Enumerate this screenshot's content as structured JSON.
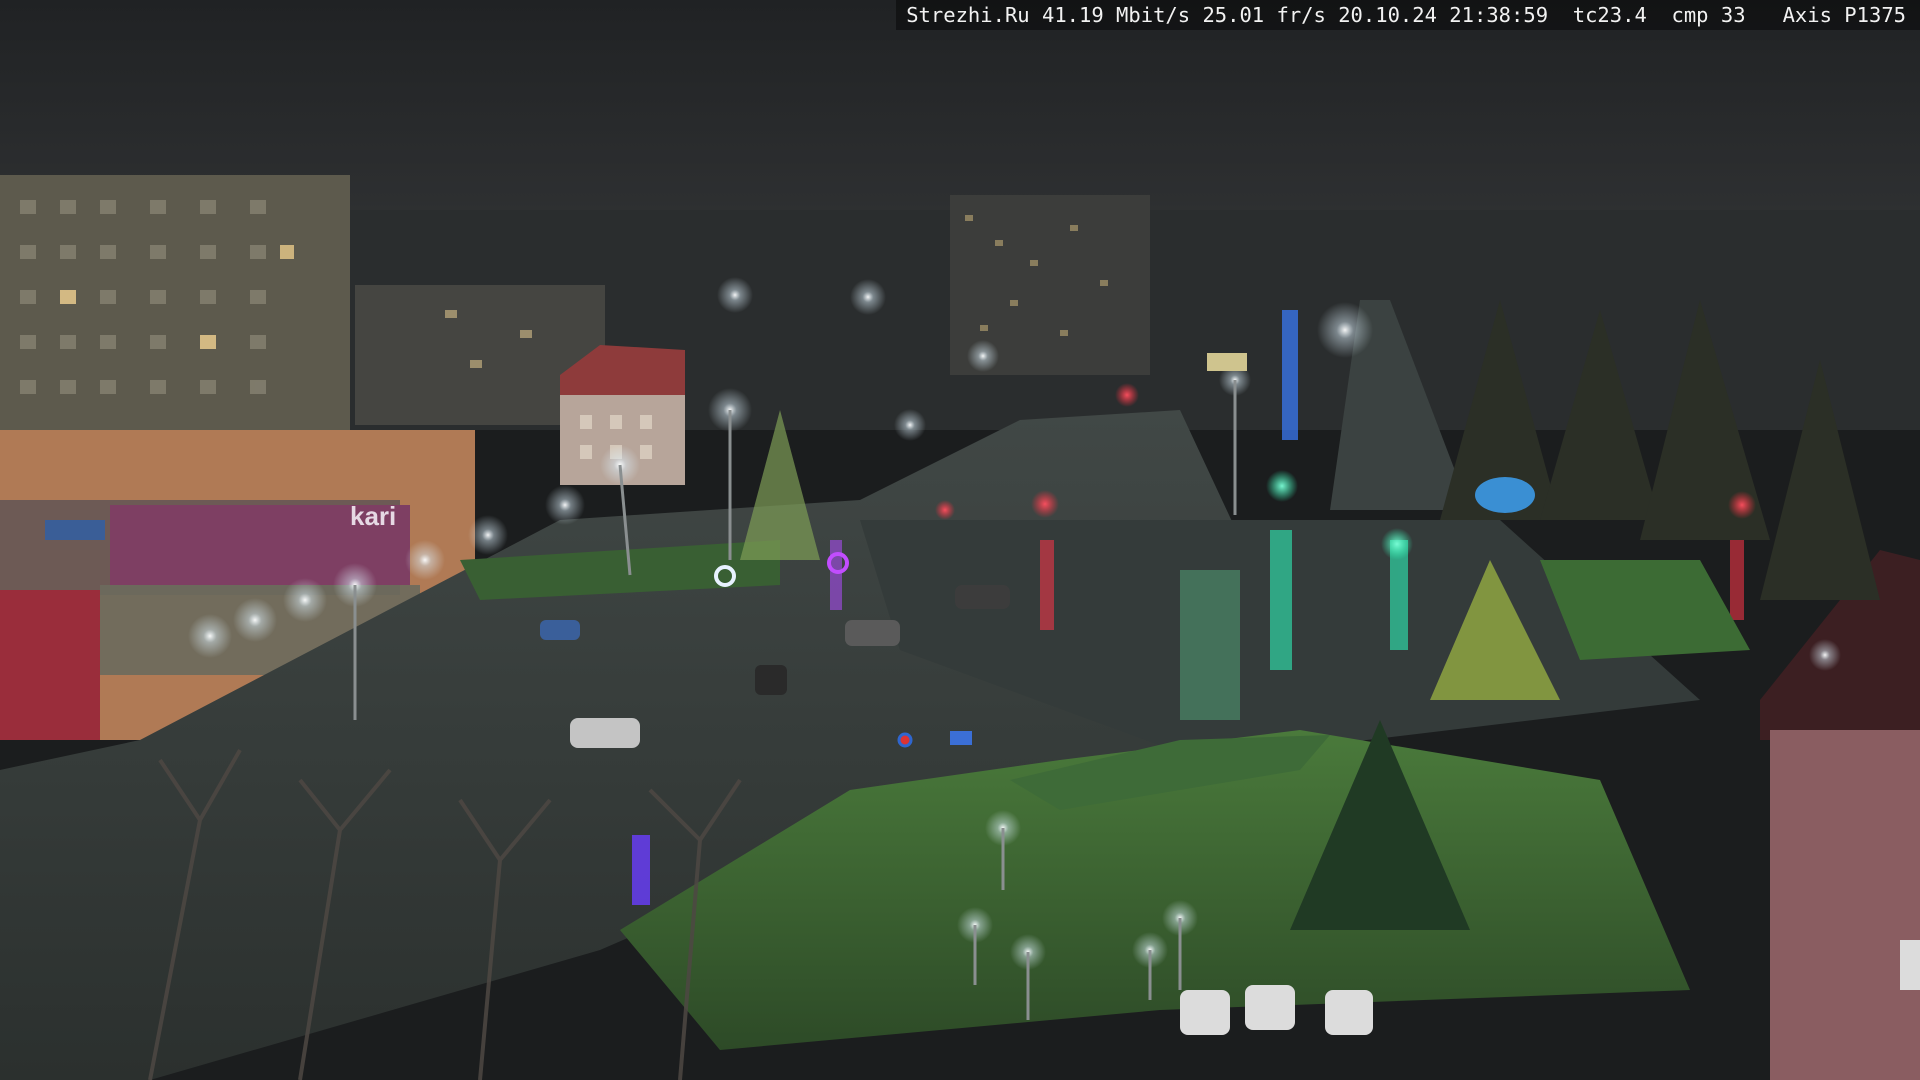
{
  "camera_overlay": {
    "site": "Strezhi.Ru",
    "bitrate": "41.19 Mbit/s",
    "framerate": "25.01 fr/s",
    "date": "20.10.24",
    "time": "21:38:59",
    "tc": "tc23.4",
    "cmp": "cmp 33",
    "model": "Axis P1375"
  },
  "scene": {
    "signs": {
      "kari": "kari"
    },
    "colors": {
      "sky": "#26282a",
      "asphalt": "#3b4340",
      "grass": "#3f6a35",
      "lamp": "#f4fbff",
      "traffic_red": "#ff2a3a",
      "traffic_green": "#2dffb8"
    }
  }
}
